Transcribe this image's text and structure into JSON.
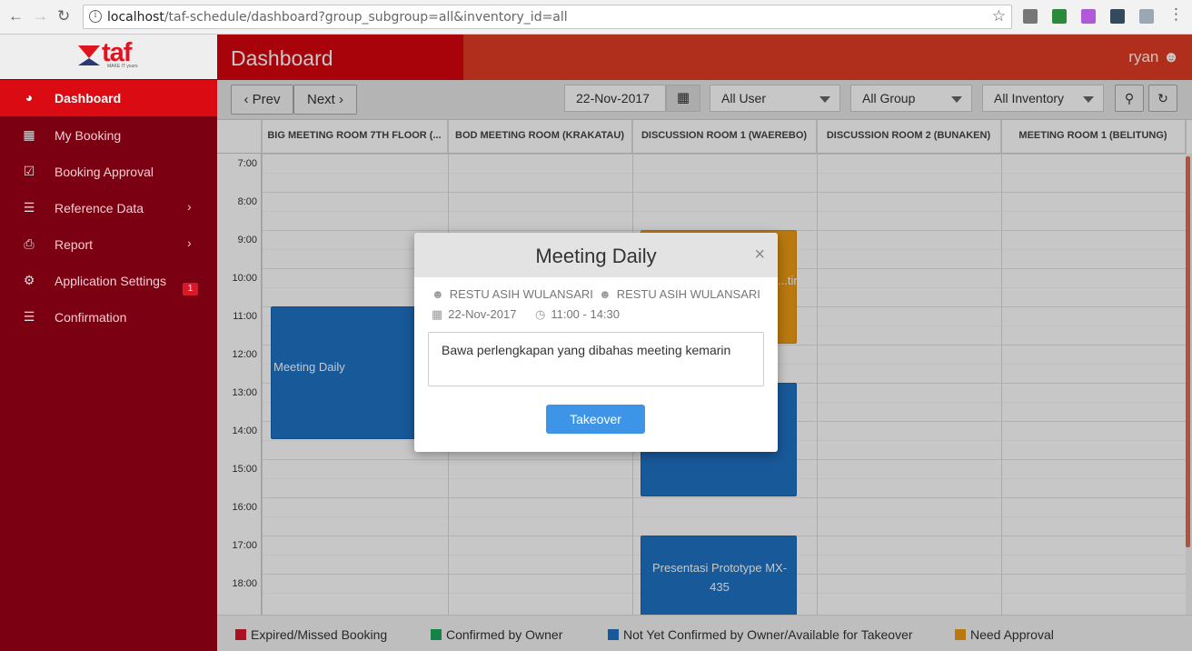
{
  "browser": {
    "url_host": "localhost",
    "url_path": "/taf-schedule/dashboard?group_subgroup=all&inventory_id=all"
  },
  "brand": {
    "name": "taf",
    "tagline": "MAKE IT yours"
  },
  "sidebar": {
    "items": [
      {
        "label": "Dashboard",
        "icon": "dashboard-icon"
      },
      {
        "label": "My Booking",
        "icon": "calendar-icon"
      },
      {
        "label": "Booking Approval",
        "icon": "checkbox-icon",
        "badge": "1"
      },
      {
        "label": "Reference Data",
        "icon": "database-icon"
      },
      {
        "label": "Report",
        "icon": "printer-icon"
      },
      {
        "label": "Application Settings",
        "icon": "gear-icon"
      },
      {
        "label": "Confirmation",
        "icon": "list-icon"
      }
    ]
  },
  "header": {
    "title": "Dashboard",
    "user": "ryan"
  },
  "toolbar": {
    "prev": "Prev",
    "next": "Next",
    "date": "22-Nov-2017",
    "user_filter": "All User",
    "group_filter": "All Group",
    "inventory_filter": "All Inventory"
  },
  "schedule": {
    "rooms": [
      "BIG MEETING ROOM 7TH FLOOR (...",
      "BOD MEETING ROOM (KRAKATAU)",
      "DISCUSSION ROOM 1 (WAEREBO)",
      "DISCUSSION ROOM 2 (BUNAKEN)",
      "MEETING ROOM 1 (BELITUNG)"
    ],
    "times": [
      "7:00",
      "8:00",
      "9:00",
      "10:00",
      "11:00",
      "12:00",
      "13:00",
      "14:00",
      "15:00",
      "16:00",
      "17:00",
      "18:00"
    ],
    "events": [
      {
        "title": "Meeting Daily",
        "room": 0,
        "start": "11:00",
        "end": "14:30",
        "color": "#1f73c6"
      },
      {
        "title": "...tin",
        "room": 2,
        "start": "9:00",
        "end": "12:00",
        "color": "#ef9b14"
      },
      {
        "title": "",
        "room": 2,
        "start": "13:00",
        "end": "16:00",
        "color": "#1f73c6"
      },
      {
        "title": "Presentasi Prototype MX-435",
        "room": 2,
        "start": "17:00",
        "end": "18:30",
        "color": "#1f73c6"
      }
    ]
  },
  "legend": [
    {
      "label": "Expired/Missed Booking",
      "color": "#d9182b"
    },
    {
      "label": "Confirmed by Owner",
      "color": "#1aa85a"
    },
    {
      "label": "Not Yet Confirmed by Owner/Available for Takeover",
      "color": "#1f73c6"
    },
    {
      "label": "Need Approval",
      "color": "#ef9b14"
    }
  ],
  "modal": {
    "title": "Meeting Daily",
    "owner": "RESTU ASIH WULANSARI",
    "group": "RESTU ASIH WULANSARI",
    "date": "22-Nov-2017",
    "time": "11:00 - 14:30",
    "note": "Bawa perlengkapan yang dibahas meeting kemarin",
    "action": "Takeover"
  }
}
